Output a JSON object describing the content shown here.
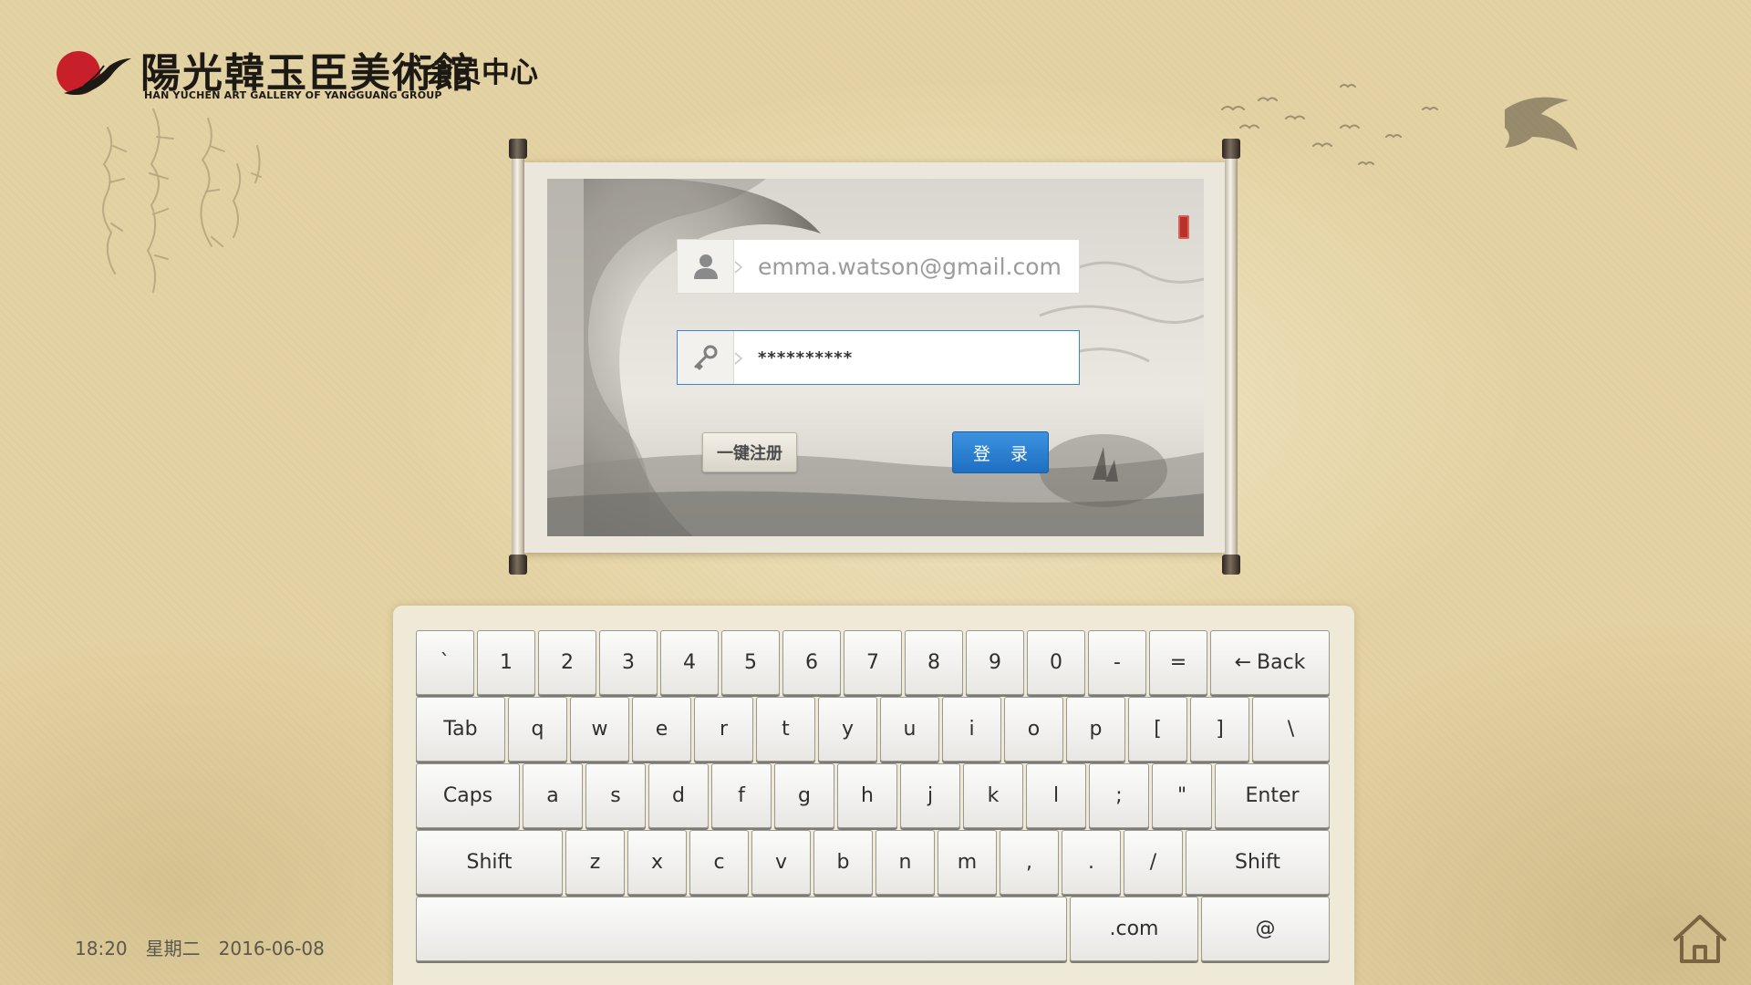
{
  "header": {
    "logo_cn": "陽光韓玉臣美術館",
    "logo_en": "HAN YUCHEN ART GALLERY OF YANGGUANG GROUP",
    "subtitle": "会员中心"
  },
  "login": {
    "email_value": "emma.watson@gmail.com",
    "password_value": "**********",
    "register_label": "一键注册",
    "login_label": "登 录"
  },
  "keyboard": {
    "rows": [
      [
        "`",
        "1",
        "2",
        "3",
        "4",
        "5",
        "6",
        "7",
        "8",
        "9",
        "0",
        "-",
        "=",
        "Back"
      ],
      [
        "Tab",
        "q",
        "w",
        "e",
        "r",
        "t",
        "y",
        "u",
        "i",
        "o",
        "p",
        "[",
        "]",
        "\\"
      ],
      [
        "Caps",
        "a",
        "s",
        "d",
        "f",
        "g",
        "h",
        "j",
        "k",
        "l",
        ";",
        "\"",
        "Enter"
      ],
      [
        "Shift",
        "z",
        "x",
        "c",
        "v",
        "b",
        "n",
        "m",
        ",",
        ".",
        "/",
        "Shift"
      ],
      [
        "",
        ".com",
        "@"
      ]
    ]
  },
  "footer": {
    "time": "18:20",
    "weekday": "星期二",
    "date": "2016-06-08"
  },
  "colors": {
    "background": "#e3d2a3",
    "accent_blue": "#2a7fd4",
    "seal_red": "#b9312b",
    "logo_red": "#c8202a"
  },
  "icons": [
    "user-icon",
    "key-icon",
    "home-icon",
    "logo-mark-icon"
  ]
}
